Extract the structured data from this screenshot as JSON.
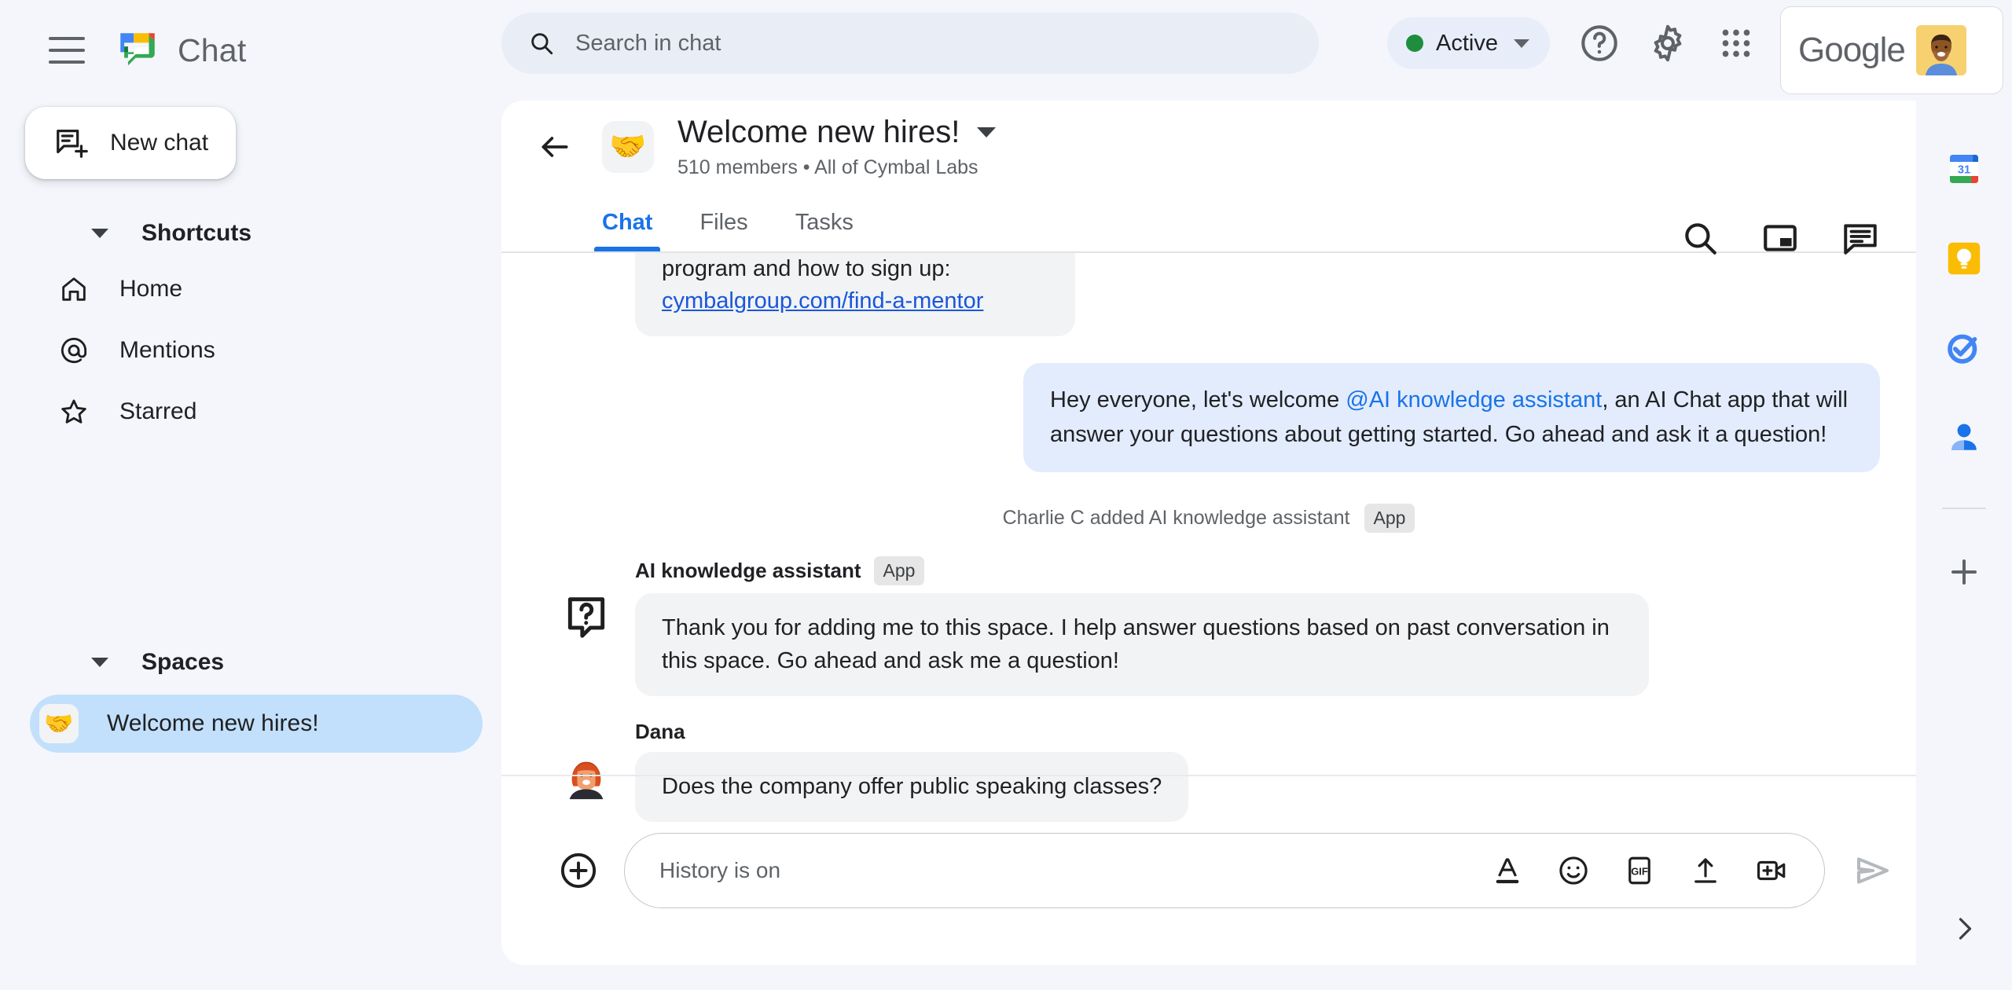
{
  "app": {
    "name": "Chat"
  },
  "topbar": {
    "menu_icon": "hamburger-menu-icon",
    "search": {
      "placeholder": "Search in chat",
      "icon": "search-icon"
    },
    "status": {
      "label": "Active",
      "color": "#1e8e3e"
    },
    "help_icon": "help-icon",
    "settings_icon": "gear-icon",
    "apps_icon": "apps-grid-icon",
    "account": {
      "brand": "Google",
      "avatar": "user-avatar"
    }
  },
  "sidebar": {
    "new_chat": {
      "label": "New chat",
      "icon": "new-chat-icon"
    },
    "shortcuts": {
      "title": "Shortcuts",
      "items": [
        {
          "label": "Home",
          "icon": "home-icon"
        },
        {
          "label": "Mentions",
          "icon": "at-icon"
        },
        {
          "label": "Starred",
          "icon": "star-icon"
        }
      ]
    },
    "spaces": {
      "title": "Spaces",
      "items": [
        {
          "label": "Welcome new hires!",
          "emoji": "🤝",
          "selected": true
        }
      ]
    }
  },
  "space_header": {
    "back_icon": "back-arrow-icon",
    "emoji": "🤝",
    "title": "Welcome new hires!",
    "members": "510 members",
    "separator": "•",
    "org": "All of Cymbal Labs",
    "subtitle": "510 members  •  All of Cymbal Labs",
    "actions": [
      "search-icon",
      "picture-in-picture-icon",
      "threads-icon"
    ]
  },
  "tabs": [
    {
      "label": "Chat",
      "active": true
    },
    {
      "label": "Files",
      "active": false
    },
    {
      "label": "Tasks",
      "active": false
    }
  ],
  "messages": {
    "partial": {
      "text": "program and how to sign up:",
      "link": "cymbalgroup.com/find-a-mentor"
    },
    "outgoing": {
      "text_before": "Hey everyone, let's welcome ",
      "mention": "@AI knowledge assistant",
      "text_after": ", an AI Chat app that will answer your questions about getting started.  Go ahead and ask it a question!"
    },
    "system": {
      "text": "Charlie C added AI knowledge assistant",
      "badge": "App"
    },
    "assistant": {
      "name": "AI knowledge assistant",
      "badge": "App",
      "avatar": "question-bubble-icon",
      "text": "Thank you for adding me to this space. I help answer questions based on past conversation in this space. Go ahead and ask me a question!"
    },
    "user": {
      "name": "Dana",
      "avatar": "dana-avatar",
      "text": "Does the company offer public speaking classes?"
    }
  },
  "composer": {
    "plus_icon": "add-icon",
    "placeholder": "History is on",
    "icons": [
      "format-text-icon",
      "emoji-icon",
      "gif-icon",
      "upload-icon",
      "video-add-icon"
    ],
    "send_icon": "send-icon"
  },
  "rail": {
    "items": [
      {
        "name": "google-calendar-icon",
        "label": "31"
      },
      {
        "name": "google-keep-icon"
      },
      {
        "name": "google-tasks-icon"
      },
      {
        "name": "google-contacts-icon"
      }
    ],
    "add_icon": "add-icon",
    "expand_icon": "chevron-right-icon"
  }
}
